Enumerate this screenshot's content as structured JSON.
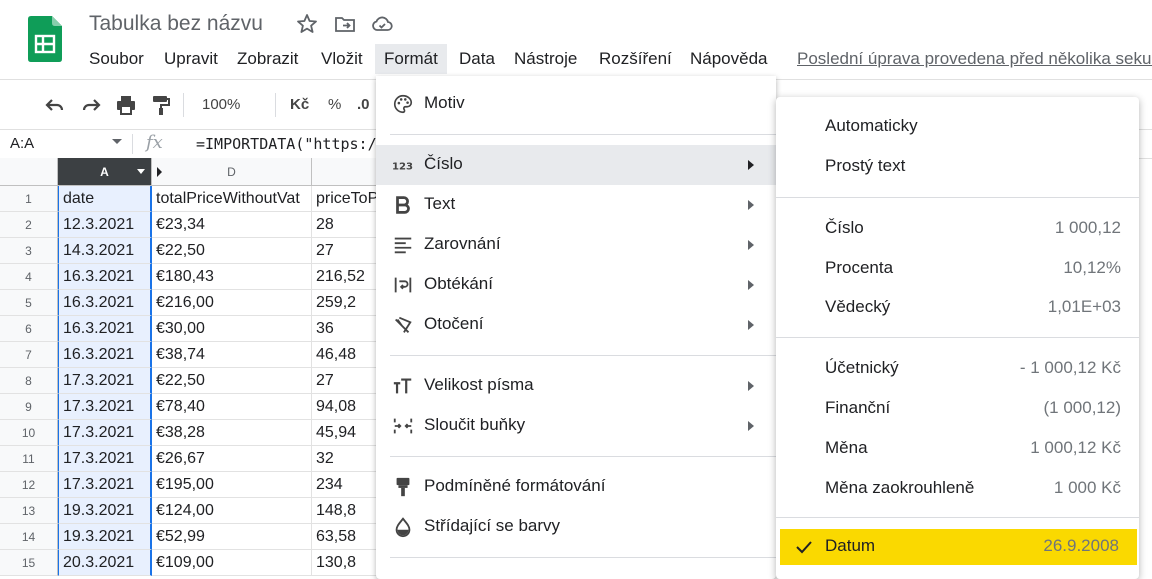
{
  "doc": {
    "title": "Tabulka bez názvu",
    "last_edit": "Poslední úprava provedena před několika sekundami"
  },
  "menubar": [
    "Soubor",
    "Upravit",
    "Zobrazit",
    "Vložit",
    "Formát",
    "Data",
    "Nástroje",
    "Rozšíření",
    "Nápověda"
  ],
  "toolbar": {
    "zoom": "100%",
    "currency": "Kč",
    "percent": "%",
    "decimal": ".0"
  },
  "formula": {
    "name_box": "A:A",
    "fx": "fx",
    "text": "=IMPORTDATA(\"https:/"
  },
  "columns": {
    "a": "A",
    "d": "D"
  },
  "rows": [
    {
      "n": "1",
      "date": "date",
      "total": "totalPriceWithoutVat",
      "price": "priceToPay"
    },
    {
      "n": "2",
      "date": "12.3.2021",
      "total": "€23,34",
      "price": "28"
    },
    {
      "n": "3",
      "date": "14.3.2021",
      "total": "€22,50",
      "price": "27"
    },
    {
      "n": "4",
      "date": "16.3.2021",
      "total": "€180,43",
      "price": "216,52"
    },
    {
      "n": "5",
      "date": "16.3.2021",
      "total": "€216,00",
      "price": "259,2"
    },
    {
      "n": "6",
      "date": "16.3.2021",
      "total": "€30,00",
      "price": "36"
    },
    {
      "n": "7",
      "date": "16.3.2021",
      "total": "€38,74",
      "price": "46,48"
    },
    {
      "n": "8",
      "date": "17.3.2021",
      "total": "€22,50",
      "price": "27"
    },
    {
      "n": "9",
      "date": "17.3.2021",
      "total": "€78,40",
      "price": "94,08"
    },
    {
      "n": "10",
      "date": "17.3.2021",
      "total": "€38,28",
      "price": "45,94"
    },
    {
      "n": "11",
      "date": "17.3.2021",
      "total": "€26,67",
      "price": "32"
    },
    {
      "n": "12",
      "date": "17.3.2021",
      "total": "€195,00",
      "price": "234"
    },
    {
      "n": "13",
      "date": "19.3.2021",
      "total": "€124,00",
      "price": "148,8"
    },
    {
      "n": "14",
      "date": "19.3.2021",
      "total": "€52,99",
      "price": "63,58"
    },
    {
      "n": "15",
      "date": "20.3.2021",
      "total": "€109,00",
      "price": "130,8"
    }
  ],
  "format_menu": {
    "theme": "Motiv",
    "number": "Číslo",
    "text": "Text",
    "align": "Zarovnání",
    "wrap": "Obtékání",
    "rotate": "Otočení",
    "font_size": "Velikost písma",
    "merge": "Sloučit buňky",
    "conditional": "Podmíněné formátování",
    "alternating": "Střídající se barvy"
  },
  "number_menu": {
    "automatic": "Automaticky",
    "plain": "Prostý text",
    "number": {
      "label": "Číslo",
      "example": "1 000,12"
    },
    "percent": {
      "label": "Procenta",
      "example": "10,12%"
    },
    "scientific": {
      "label": "Vědecký",
      "example": "1,01E+03"
    },
    "accounting": {
      "label": "Účetnický",
      "example": "- 1 000,12 Kč"
    },
    "financial": {
      "label": "Finanční",
      "example": "(1 000,12)"
    },
    "currency": {
      "label": "Měna",
      "example": "1 000,12 Kč"
    },
    "currency_rounded": {
      "label": "Měna zaokrouhleně",
      "example": "1 000 Kč"
    },
    "date": {
      "label": "Datum",
      "example": "26.9.2008"
    }
  },
  "colors": {
    "highlight": "#fad900",
    "selection": "#e8f0fe",
    "logo": "#0f9d58"
  }
}
